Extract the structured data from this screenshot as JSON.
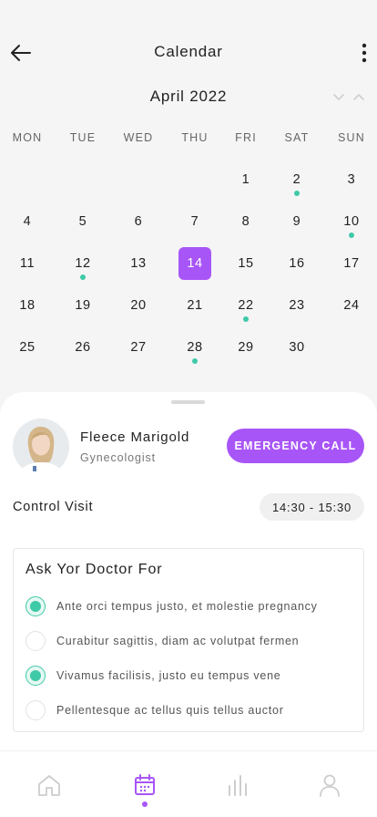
{
  "header": {
    "title": "Calendar",
    "back_icon": "arrow-left-icon",
    "more_icon": "more-vertical-icon"
  },
  "calendar": {
    "month": "April 2022",
    "weekdays": [
      "MON",
      "TUE",
      "WED",
      "THU",
      "FRI",
      "SAT",
      "SUN"
    ],
    "first_weekday_index": 4,
    "days_in_month": 30,
    "selected_day": 14,
    "marked_days": [
      2,
      10,
      12,
      22,
      28
    ]
  },
  "doctor": {
    "name": "Fleece Marigold",
    "specialty": "Gynecologist",
    "emergency_label": "EMERGENCY CALL"
  },
  "visit": {
    "label": "Control Visit",
    "time": "14:30 - 15:30"
  },
  "ask": {
    "title": "Ask Yor Doctor For",
    "items": [
      {
        "text": "Ante orci tempus justo, et molestie pregnancy",
        "checked": true
      },
      {
        "text": "Curabitur sagittis, diam ac volutpat fermen",
        "checked": false
      },
      {
        "text": "Vivamus facilisis, justo eu tempus vene",
        "checked": true
      },
      {
        "text": "Pellentesque ac tellus quis tellus auctor",
        "checked": false
      }
    ]
  },
  "nav": {
    "items": [
      {
        "icon": "home-icon",
        "active": false
      },
      {
        "icon": "calendar-icon",
        "active": true
      },
      {
        "icon": "stats-icon",
        "active": false
      },
      {
        "icon": "profile-icon",
        "active": false
      }
    ]
  },
  "colors": {
    "accent": "#a855f7",
    "mark": "#3ec9a7"
  }
}
